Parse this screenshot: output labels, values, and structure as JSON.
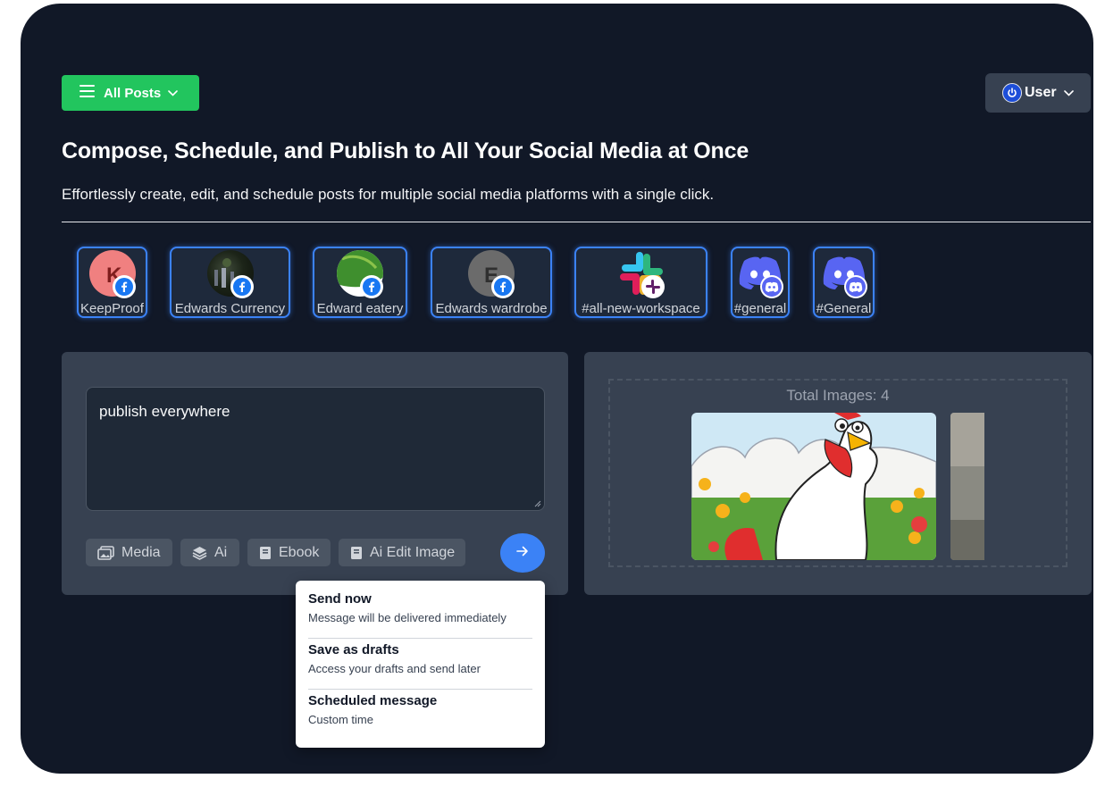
{
  "header": {
    "posts_button_label": "All Posts",
    "user_button_label": "User"
  },
  "hero": {
    "title": "Compose, Schedule, and Publish to All Your Social Media at Once",
    "subtitle": "Effortlessly create, edit, and schedule posts for multiple social media platforms with a single click."
  },
  "accounts": [
    {
      "name": "KeepProof",
      "platform": "facebook"
    },
    {
      "name": "Edwards Currency",
      "platform": "facebook"
    },
    {
      "name": "Edward eatery",
      "platform": "facebook"
    },
    {
      "name": "Edwards wardrobe",
      "platform": "facebook"
    },
    {
      "name": "#all-new-workspace",
      "platform": "slack"
    },
    {
      "name": "#general",
      "platform": "discord"
    },
    {
      "name": "#General",
      "platform": "discord"
    }
  ],
  "avatar_letters": {
    "keepproof": "K",
    "wardrobe": "E"
  },
  "composer": {
    "text": "publish everywhere",
    "tools": [
      "Media",
      "Ai",
      "Ebook",
      "Ai Edit Image"
    ]
  },
  "media": {
    "total_label": "Total Images: 4"
  },
  "send_menu": [
    {
      "title": "Send now",
      "desc": "Message will be delivered immediately"
    },
    {
      "title": "Save as drafts",
      "desc": "Access your drafts and send later"
    },
    {
      "title": "Scheduled message",
      "desc": "Custom time"
    }
  ],
  "colors": {
    "background": "#111827",
    "accent_green": "#22c55e",
    "accent_blue": "#3b82f6",
    "panel": "#374151"
  }
}
